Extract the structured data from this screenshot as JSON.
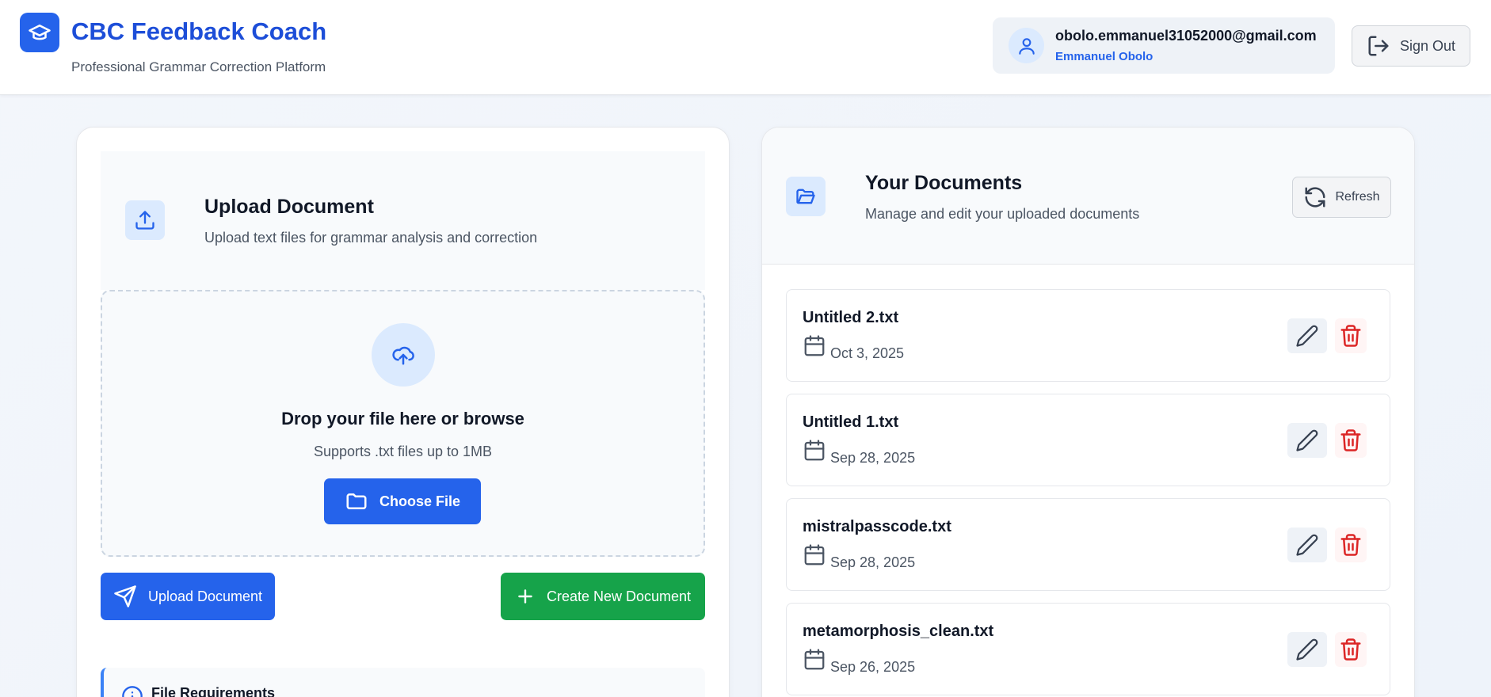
{
  "header": {
    "title": "CBC Feedback Coach",
    "subtitle": "Professional Grammar Correction Platform",
    "logo_icon": "graduation-cap-icon",
    "user": {
      "email": "obolo.emmanuel31052000@gmail.com",
      "name": "Emmanuel Obolo",
      "avatar_icon": "user-icon"
    },
    "signout_label": "Sign Out"
  },
  "upload": {
    "title": "Upload Document",
    "description": "Upload text files for grammar analysis and correction",
    "dropzone": {
      "title": "Drop your file here or browse",
      "subtitle": "Supports .txt files up to 1MB",
      "choose_label": "Choose File"
    },
    "upload_label": "Upload Document",
    "create_label": "Create New Document",
    "requirements_title": "File Requirements"
  },
  "documents": {
    "title": "Your Documents",
    "description": "Manage and edit your uploaded documents",
    "refresh_label": "Refresh",
    "items": [
      {
        "name": "Untitled 2.txt",
        "date": "Oct 3, 2025"
      },
      {
        "name": "Untitled 1.txt",
        "date": "Sep 28, 2025"
      },
      {
        "name": "mistralpasscode.txt",
        "date": "Sep 28, 2025"
      },
      {
        "name": "metamorphosis_clean.txt",
        "date": "Sep 26, 2025"
      }
    ]
  },
  "colors": {
    "primary": "#2563eb",
    "success": "#16a34a",
    "danger": "#dc2626",
    "brand_text": "#1d4ed8"
  }
}
